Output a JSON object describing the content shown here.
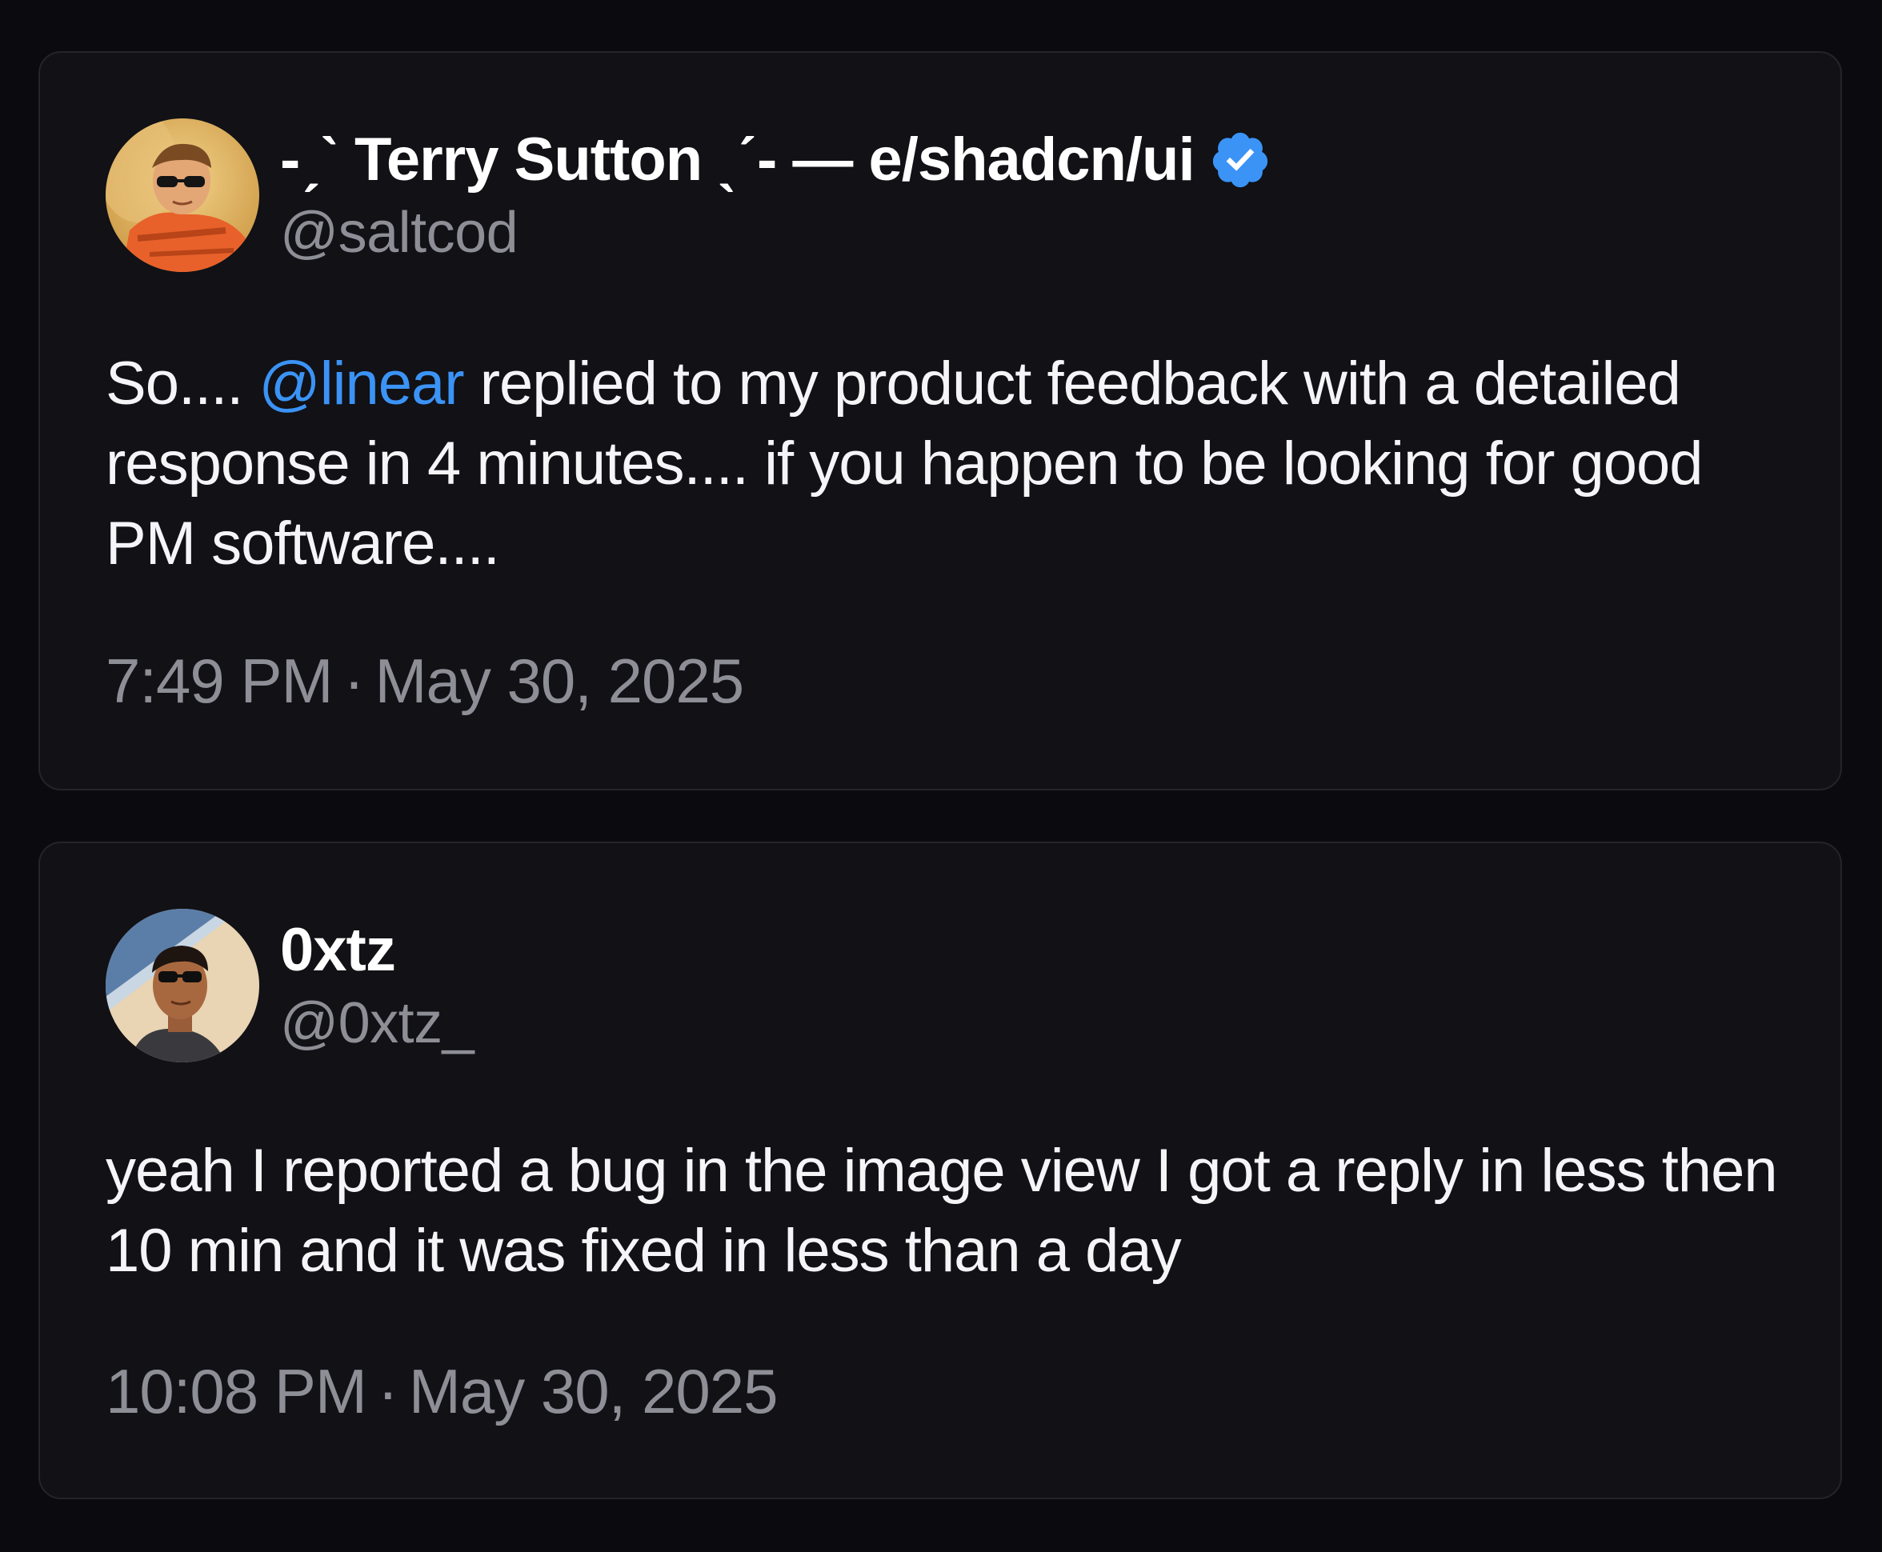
{
  "tweets": [
    {
      "display_name": "-ˏˋ Terry Sutton ˎˊ- — e/shadcn/ui",
      "verified": true,
      "handle": "@saltcod",
      "text_prefix": "So.... ",
      "mention": "@linear",
      "text_suffix": " replied to my product feedback with a detailed response in 4 minutes.... if you happen to be looking for good PM software....",
      "time": "7:49 PM",
      "separator": "·",
      "date": "May 30, 2025",
      "avatar_icon": "avatar-life-jacket-sunglasses"
    },
    {
      "display_name": "0xtz",
      "verified": false,
      "handle": "@0xtz_",
      "text": "yeah I reported a bug in the image view I got a reply in less then 10 min and it was fixed in less than a day",
      "time": "10:08 PM",
      "separator": "·",
      "date": "May 30, 2025",
      "avatar_icon": "avatar-sunglasses-selfie"
    }
  ],
  "colors": {
    "background": "#0b0b0f",
    "card": "#111116",
    "mention": "#3b93f5",
    "verified_badge": "#3b93f5",
    "secondary_text": "#8e8e96"
  }
}
